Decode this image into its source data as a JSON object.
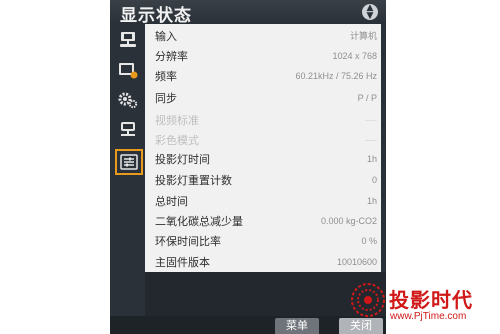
{
  "osd": {
    "title": "显示状态",
    "nav_icon": "up-down-arrows-icon"
  },
  "sidebar": {
    "items": [
      {
        "name": "input-source-icon",
        "active": false
      },
      {
        "name": "picture-adjust-icon",
        "active": false
      },
      {
        "name": "settings-gears-icon",
        "active": false
      },
      {
        "name": "network-usb-icon",
        "active": false
      },
      {
        "name": "status-info-icon",
        "active": true
      }
    ]
  },
  "rows": [
    {
      "label": "输入",
      "value": "计算机",
      "disabled": false
    },
    {
      "label": "分辨率",
      "value": "1024 x 768",
      "disabled": false
    },
    {
      "label": "频率",
      "value": "60.21kHz / 75.26 Hz",
      "disabled": false
    },
    {
      "label": "同步",
      "value": "P / P",
      "disabled": false
    },
    {
      "label": "视频标准",
      "value": "----",
      "disabled": true
    },
    {
      "label": "彩色模式",
      "value": "----",
      "disabled": true
    },
    {
      "label": "投影灯时间",
      "value": "1h",
      "disabled": false
    },
    {
      "label": "投影灯重置计数",
      "value": "0",
      "disabled": false
    },
    {
      "label": "总时间",
      "value": "1h",
      "disabled": false
    },
    {
      "label": "二氧化碳总减少量",
      "value": "0.000 kg-CO2",
      "disabled": false
    },
    {
      "label": "环保时间比率",
      "value": "0 %",
      "disabled": false
    },
    {
      "label": "主固件版本",
      "value": "10010600",
      "disabled": false
    }
  ],
  "footer": {
    "menu_label": "菜单",
    "close_label": "关闭"
  },
  "watermark": {
    "brand": "投影时代",
    "url": "www.PjTime.com",
    "color": "#d01818"
  },
  "colors": {
    "accent": "#e89a1c",
    "osd_bg": "#2b3138",
    "panel_bg": "#f1f1f1"
  }
}
